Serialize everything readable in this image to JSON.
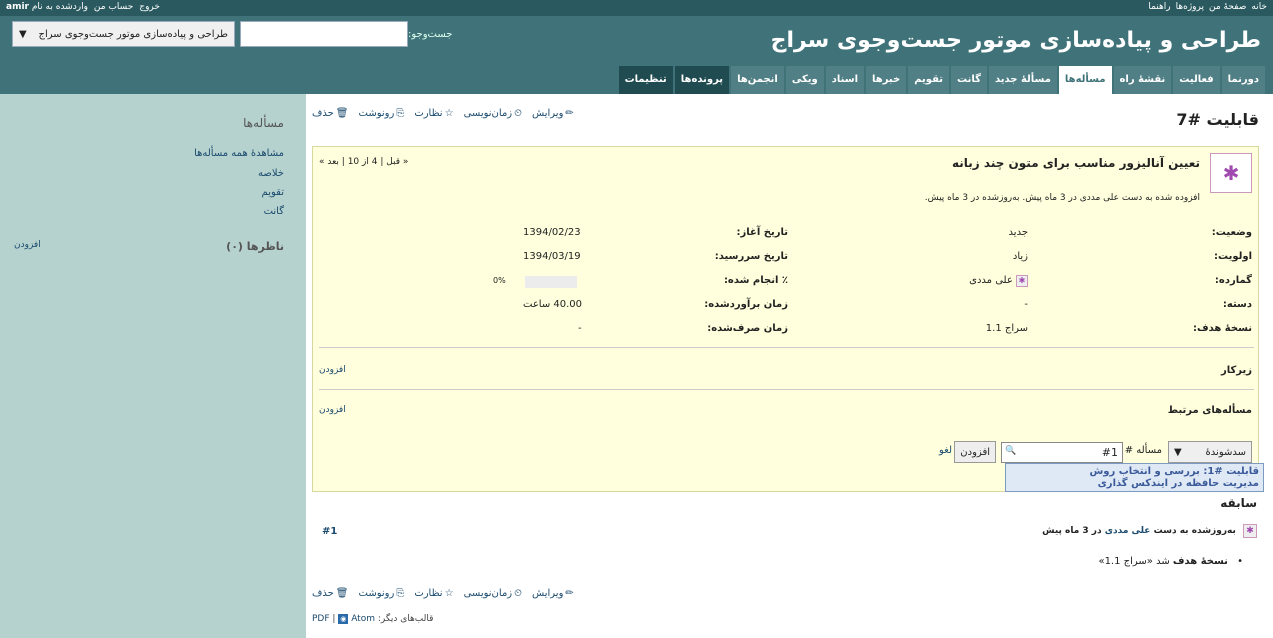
{
  "top_menu": {
    "right_items": [
      "خانه",
      "صفحهٔ من",
      "پروژه‌ها",
      "راهنما"
    ],
    "logged_in_prefix": "واردشده به نام",
    "logged_in_user": "amir",
    "account": "حساب من",
    "logout": "خروج"
  },
  "header": {
    "title": "طراحی و پیاده‌سازی موتور جست‌وجوی سراج",
    "search_label": "جست‌وجو:",
    "search_value": "",
    "project_jump": "طراحی و پیاده‌سازی موتور جست‌وجوی سراج",
    "tabs": [
      "دورنما",
      "فعالیت",
      "نقشهٔ راه",
      "مسأله‌ها",
      "مسألهٔ جدید",
      "گانت",
      "تقویم",
      "خبرها",
      "اسناد",
      "ویکی",
      "انجمن‌ها",
      "پرونده‌ها",
      "تنظیمات"
    ],
    "selected_tab": "مسأله‌ها"
  },
  "sidebar": {
    "issues_heading": "مسأله‌ها",
    "links": [
      "مشاهدهٔ همه مسأله‌ها",
      "خلاصه",
      "تقویم",
      "گانت"
    ],
    "watchers_heading": "ناظرها (۰)",
    "watchers_add": "افزودن"
  },
  "contextual": {
    "edit": "ویرایش",
    "log_time": "زمان‌نویسی",
    "watch": "نظارت",
    "copy": "رونوشت",
    "delete": "حذف"
  },
  "issue": {
    "title": "قابلیت #7",
    "subject": "تعیین آنالیزور مناسب برای متون چند زبانه",
    "author_line": "افزوده شده به دست علی مددی در 3 ماه پیش. به‌روزشده در 3 ماه پیش.",
    "pager": "« قبل | 4 از 10 | بعد »",
    "status_label": "وضعیت:",
    "status": "جدید",
    "priority_label": "اولویت:",
    "priority": "زیاد",
    "assignee_label": "گمارده:",
    "assignee": "علی مددی",
    "category_label": "دسته:",
    "category": "-",
    "target_label": "نسخهٔ هدف:",
    "target": "سراج 1.1",
    "start_label": "تاریخ آغاز:",
    "start": "1394/02/23",
    "due_label": "تاریخ سررسید:",
    "due": "1394/03/19",
    "done_label": "٪ انجام شده:",
    "done": "0%",
    "done_fraction": 0,
    "estimated_label": "زمان برآوردشده:",
    "estimated": "40.00 ساعت",
    "spent_label": "زمان صرف‌شده:",
    "spent": "-",
    "subtasks_heading": "زیرکار",
    "subtasks_add": "افزودن",
    "related_heading": "مسأله‌های مرتبط",
    "related_add": "افزودن"
  },
  "relation_form": {
    "type": "سدشوندهٔ",
    "issue_label": "مسأله #",
    "input_value": "#1",
    "add_button": "افزودن",
    "cancel": "لغو",
    "autocomplete_line1": "قابلیت #1: بررسی و انتخاب روش",
    "autocomplete_line2": "مدیریت حافظه در ایندکس گذاری"
  },
  "history": {
    "title": "سابقه",
    "journal_prefix": "به‌روزشده به دست",
    "journal_author": "علی مددی",
    "journal_suffix": "در 3 ماه پیش",
    "journal_number": "#1",
    "detail_field": "نسخهٔ هدف",
    "detail_text": "شد «سراج 1.1»"
  },
  "formats": {
    "label": "قالب‌های دیگر:",
    "atom": "Atom",
    "pdf": "PDF"
  }
}
